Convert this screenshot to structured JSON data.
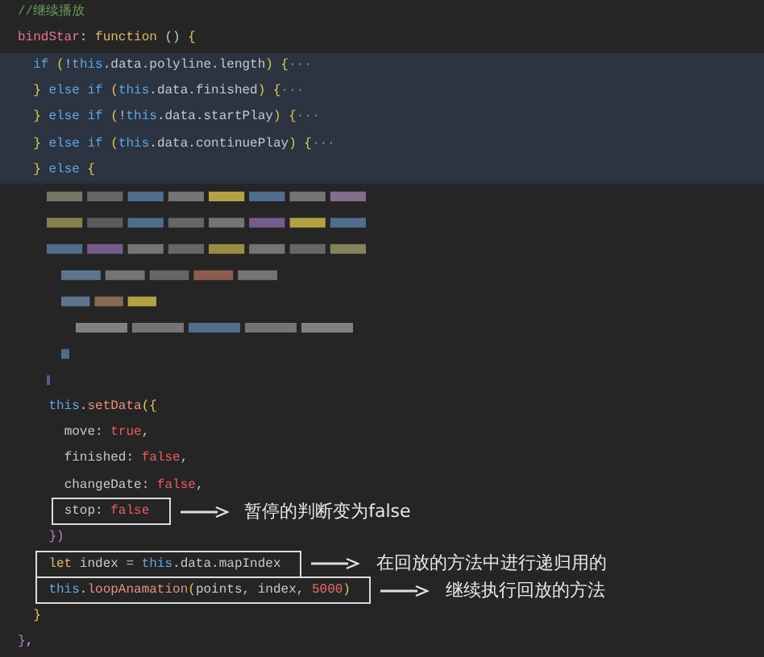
{
  "editor": {
    "lines": [
      {
        "kind": "code",
        "highlighted": false,
        "tokens": [
          {
            "kind": "comment",
            "text": "//继续播放"
          }
        ]
      },
      {
        "kind": "code",
        "highlighted": false,
        "tokens": [
          {
            "kind": "prop",
            "text": "bindStar"
          },
          {
            "kind": "plain",
            "text": ": "
          },
          {
            "kind": "func",
            "text": "function"
          },
          {
            "kind": "plain",
            "text": " () "
          },
          {
            "kind": "brace",
            "text": "{"
          }
        ]
      },
      {
        "kind": "code",
        "highlighted": true,
        "tokens": [
          {
            "kind": "keyword",
            "text": "  if"
          },
          {
            "kind": "brace",
            "text": " ("
          },
          {
            "kind": "plain",
            "text": "!"
          },
          {
            "kind": "keyword",
            "text": "this"
          },
          {
            "kind": "plain",
            "text": ".data.polyline.length"
          },
          {
            "kind": "brace",
            "text": ") {"
          },
          {
            "kind": "fold",
            "text": "···"
          }
        ]
      },
      {
        "kind": "code",
        "highlighted": true,
        "tokens": [
          {
            "kind": "brace",
            "text": "  }"
          },
          {
            "kind": "keyword",
            "text": " else if"
          },
          {
            "kind": "brace",
            "text": " ("
          },
          {
            "kind": "keyword",
            "text": "this"
          },
          {
            "kind": "plain",
            "text": ".data.finished"
          },
          {
            "kind": "brace",
            "text": ") {"
          },
          {
            "kind": "fold",
            "text": "···"
          }
        ]
      },
      {
        "kind": "code",
        "highlighted": true,
        "tokens": [
          {
            "kind": "brace",
            "text": "  }"
          },
          {
            "kind": "keyword",
            "text": " else if"
          },
          {
            "kind": "brace",
            "text": " ("
          },
          {
            "kind": "plain",
            "text": "!"
          },
          {
            "kind": "keyword",
            "text": "this"
          },
          {
            "kind": "plain",
            "text": ".data.startPlay"
          },
          {
            "kind": "brace",
            "text": ") {"
          },
          {
            "kind": "fold",
            "text": "···"
          }
        ]
      },
      {
        "kind": "code",
        "highlighted": true,
        "tokens": [
          {
            "kind": "brace",
            "text": "  }"
          },
          {
            "kind": "keyword",
            "text": " else if"
          },
          {
            "kind": "brace",
            "text": " ("
          },
          {
            "kind": "keyword",
            "text": "this"
          },
          {
            "kind": "plain",
            "text": ".data.continuePlay"
          },
          {
            "kind": "brace",
            "text": ") {"
          },
          {
            "kind": "fold",
            "text": "···"
          }
        ]
      },
      {
        "kind": "code",
        "highlighted": true,
        "tokens": [
          {
            "kind": "brace",
            "text": "  }"
          },
          {
            "kind": "keyword",
            "text": " else"
          },
          {
            "kind": "brace",
            "text": " {"
          }
        ]
      },
      {
        "kind": "pixelated"
      },
      {
        "kind": "code",
        "highlighted": false,
        "tokens": [
          {
            "kind": "keyword",
            "text": "    this"
          },
          {
            "kind": "plain",
            "text": "."
          },
          {
            "kind": "call",
            "text": "setData"
          },
          {
            "kind": "brace",
            "text": "({"
          }
        ]
      },
      {
        "kind": "code",
        "highlighted": false,
        "tokens": [
          {
            "kind": "plain",
            "text": "      move: "
          },
          {
            "kind": "bool",
            "text": "true"
          },
          {
            "kind": "plain",
            "text": ","
          }
        ]
      },
      {
        "kind": "code",
        "highlighted": false,
        "tokens": [
          {
            "kind": "plain",
            "text": "      finished: "
          },
          {
            "kind": "bool",
            "text": "false"
          },
          {
            "kind": "plain",
            "text": ","
          }
        ]
      },
      {
        "kind": "code",
        "highlighted": false,
        "tokens": [
          {
            "kind": "plain",
            "text": "      changeDate: "
          },
          {
            "kind": "bool",
            "text": "false"
          },
          {
            "kind": "plain",
            "text": ","
          }
        ]
      },
      {
        "kind": "code",
        "highlighted": false,
        "tokens": [
          {
            "kind": "plain",
            "text": "      stop: "
          },
          {
            "kind": "bool",
            "text": "false"
          }
        ],
        "note": "暂停的判断变为false"
      },
      {
        "kind": "code",
        "highlighted": false,
        "tokens": [
          {
            "kind": "brace2",
            "text": "    })"
          }
        ]
      },
      {
        "kind": "code",
        "highlighted": false,
        "tokens": [
          {
            "kind": "func",
            "text": "    let"
          },
          {
            "kind": "plain",
            "text": " index = "
          },
          {
            "kind": "keyword",
            "text": "this"
          },
          {
            "kind": "plain",
            "text": ".data.mapIndex"
          }
        ],
        "note": "在回放的方法中进行递归用的"
      },
      {
        "kind": "code",
        "highlighted": false,
        "tokens": [
          {
            "kind": "keyword",
            "text": "    this"
          },
          {
            "kind": "plain",
            "text": "."
          },
          {
            "kind": "call",
            "text": "loopAnamation"
          },
          {
            "kind": "brace",
            "text": "("
          },
          {
            "kind": "plain",
            "text": "points, index, "
          },
          {
            "kind": "number",
            "text": "5000"
          },
          {
            "kind": "brace",
            "text": ")"
          }
        ],
        "note": "继续执行回放的方法"
      },
      {
        "kind": "code",
        "highlighted": false,
        "tokens": [
          {
            "kind": "brace",
            "text": "  }"
          }
        ]
      },
      {
        "kind": "code",
        "highlighted": false,
        "tokens": [
          {
            "kind": "brace2",
            "text": "}"
          },
          {
            "kind": "plain",
            "text": ","
          }
        ]
      }
    ]
  }
}
